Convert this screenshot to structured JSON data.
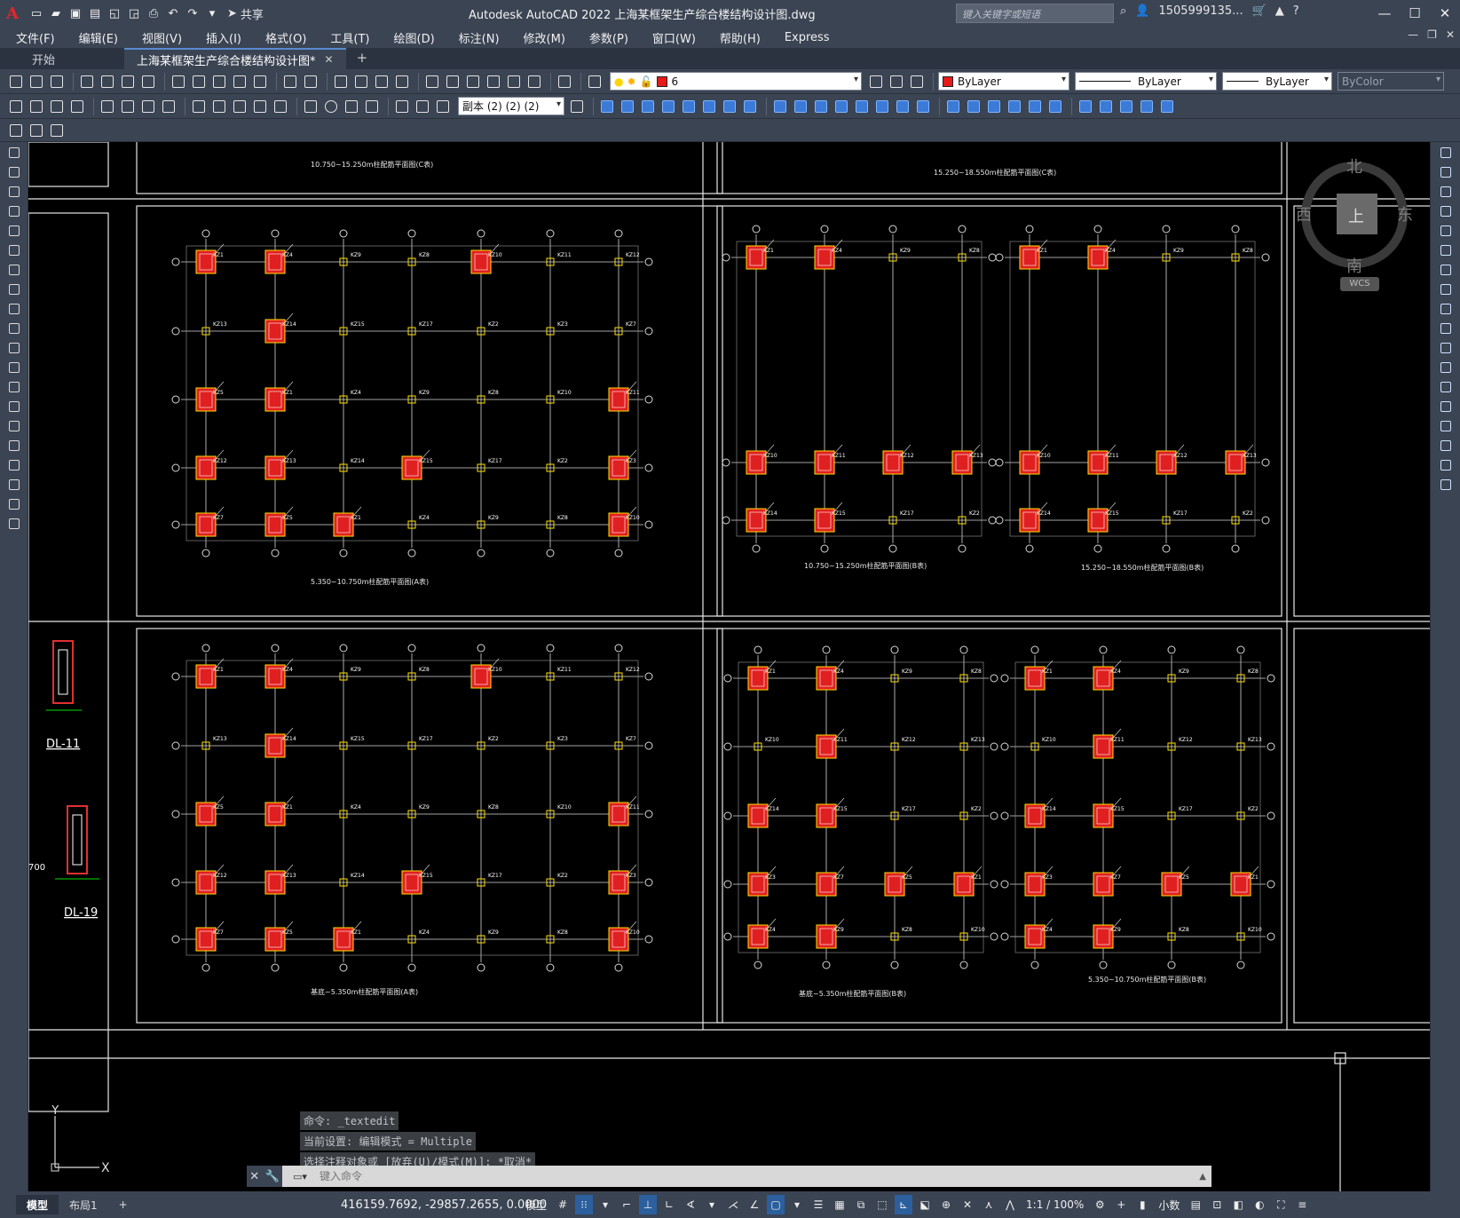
{
  "app": {
    "title": "Autodesk AutoCAD 2022    上海某框架生产综合楼结构设计图.dwg",
    "logo": "A",
    "share_label": "共享",
    "search_placeholder": "键入关键字或短语",
    "user": "1505999135...",
    "help": "?"
  },
  "menu": [
    "文件(F)",
    "编辑(E)",
    "视图(V)",
    "插入(I)",
    "格式(O)",
    "工具(T)",
    "绘图(D)",
    "标注(N)",
    "修改(M)",
    "参数(P)",
    "窗口(W)",
    "帮助(H)",
    "Express"
  ],
  "tabs": {
    "start": "开始",
    "active": "上海某框架生产综合楼结构设计图*",
    "close": "✕",
    "add": "+"
  },
  "toolbar": {
    "layer_value": "6",
    "color_value": "ByLayer",
    "linetype_value": "ByLayer",
    "lineweight_value": "ByLayer",
    "plotstyle_value": "ByColor",
    "dimstyle_value": "副本 (2) (2) (2)",
    "accent_color": "#e51a1a"
  },
  "viewcube": {
    "north": "北",
    "south": "南",
    "east": "东",
    "west": "西",
    "top": "上",
    "wcs": "WCS"
  },
  "drawing": {
    "title_top_left": "10.750~15.250m柱配筋平面图(C表)",
    "title_top_right": "15.250~18.550m柱配筋平面图(C表)",
    "panel1_title": "5.350~10.750m柱配筋平面图(A表)",
    "panel2_title_a": "10.750~15.250m柱配筋平面图(B表)",
    "panel2_title_b": "15.250~18.550m柱配筋平面图(B表)",
    "panel3_title": "基底~5.350m柱配筋平面图(A表)",
    "panel4_title_a": "基底~5.350m柱配筋平面图(B表)",
    "panel4_title_b": "5.350~10.750m柱配筋平面图(B表)",
    "detail1_label": "DL-11",
    "detail2_label": "DL-19",
    "detail_dim": "700",
    "col_labels": [
      "KZ1",
      "KZ4",
      "KZ9",
      "KZ8",
      "KZ10",
      "KZ11",
      "KZ12",
      "KZ13",
      "KZ14",
      "KZ15",
      "KZ17",
      "KZ2",
      "KZ3",
      "KZ7",
      "KZ5"
    ]
  },
  "ucs": {
    "y": "Y",
    "x": "X"
  },
  "command": {
    "history": [
      "命令: _textedit",
      "当前设置: 编辑模式 = Multiple",
      "选择注释对象或 [放弃(U)/模式(M)]: *取消*"
    ],
    "placeholder": "键入命令"
  },
  "status": {
    "layout_tabs": [
      "模型",
      "布局1"
    ],
    "add_layout": "+",
    "coords": "416159.7692, -29857.2655, 0.0000",
    "model": "模型",
    "scale": "1:1 / 100%",
    "units": "小数"
  }
}
